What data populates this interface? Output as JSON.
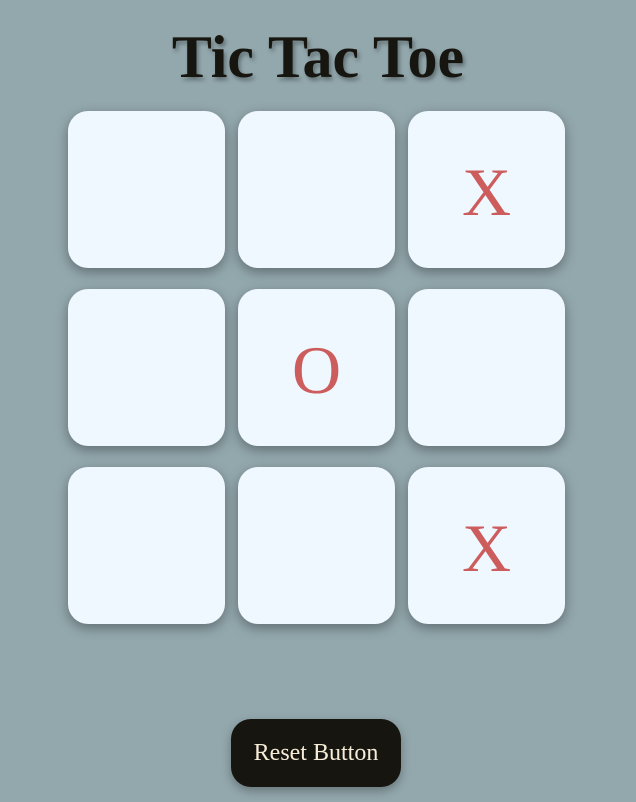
{
  "title": "Tic Tac Toe",
  "board": {
    "cells": [
      "",
      "",
      "X",
      "",
      "O",
      "",
      "",
      "",
      "X"
    ]
  },
  "reset_label": "Reset Button",
  "colors": {
    "background": "#93a8ad",
    "cell": "#eff7ff",
    "mark": "#cd5c5c",
    "title": "#16150f",
    "button": "#16150f",
    "button_text": "#f6ecd8"
  }
}
